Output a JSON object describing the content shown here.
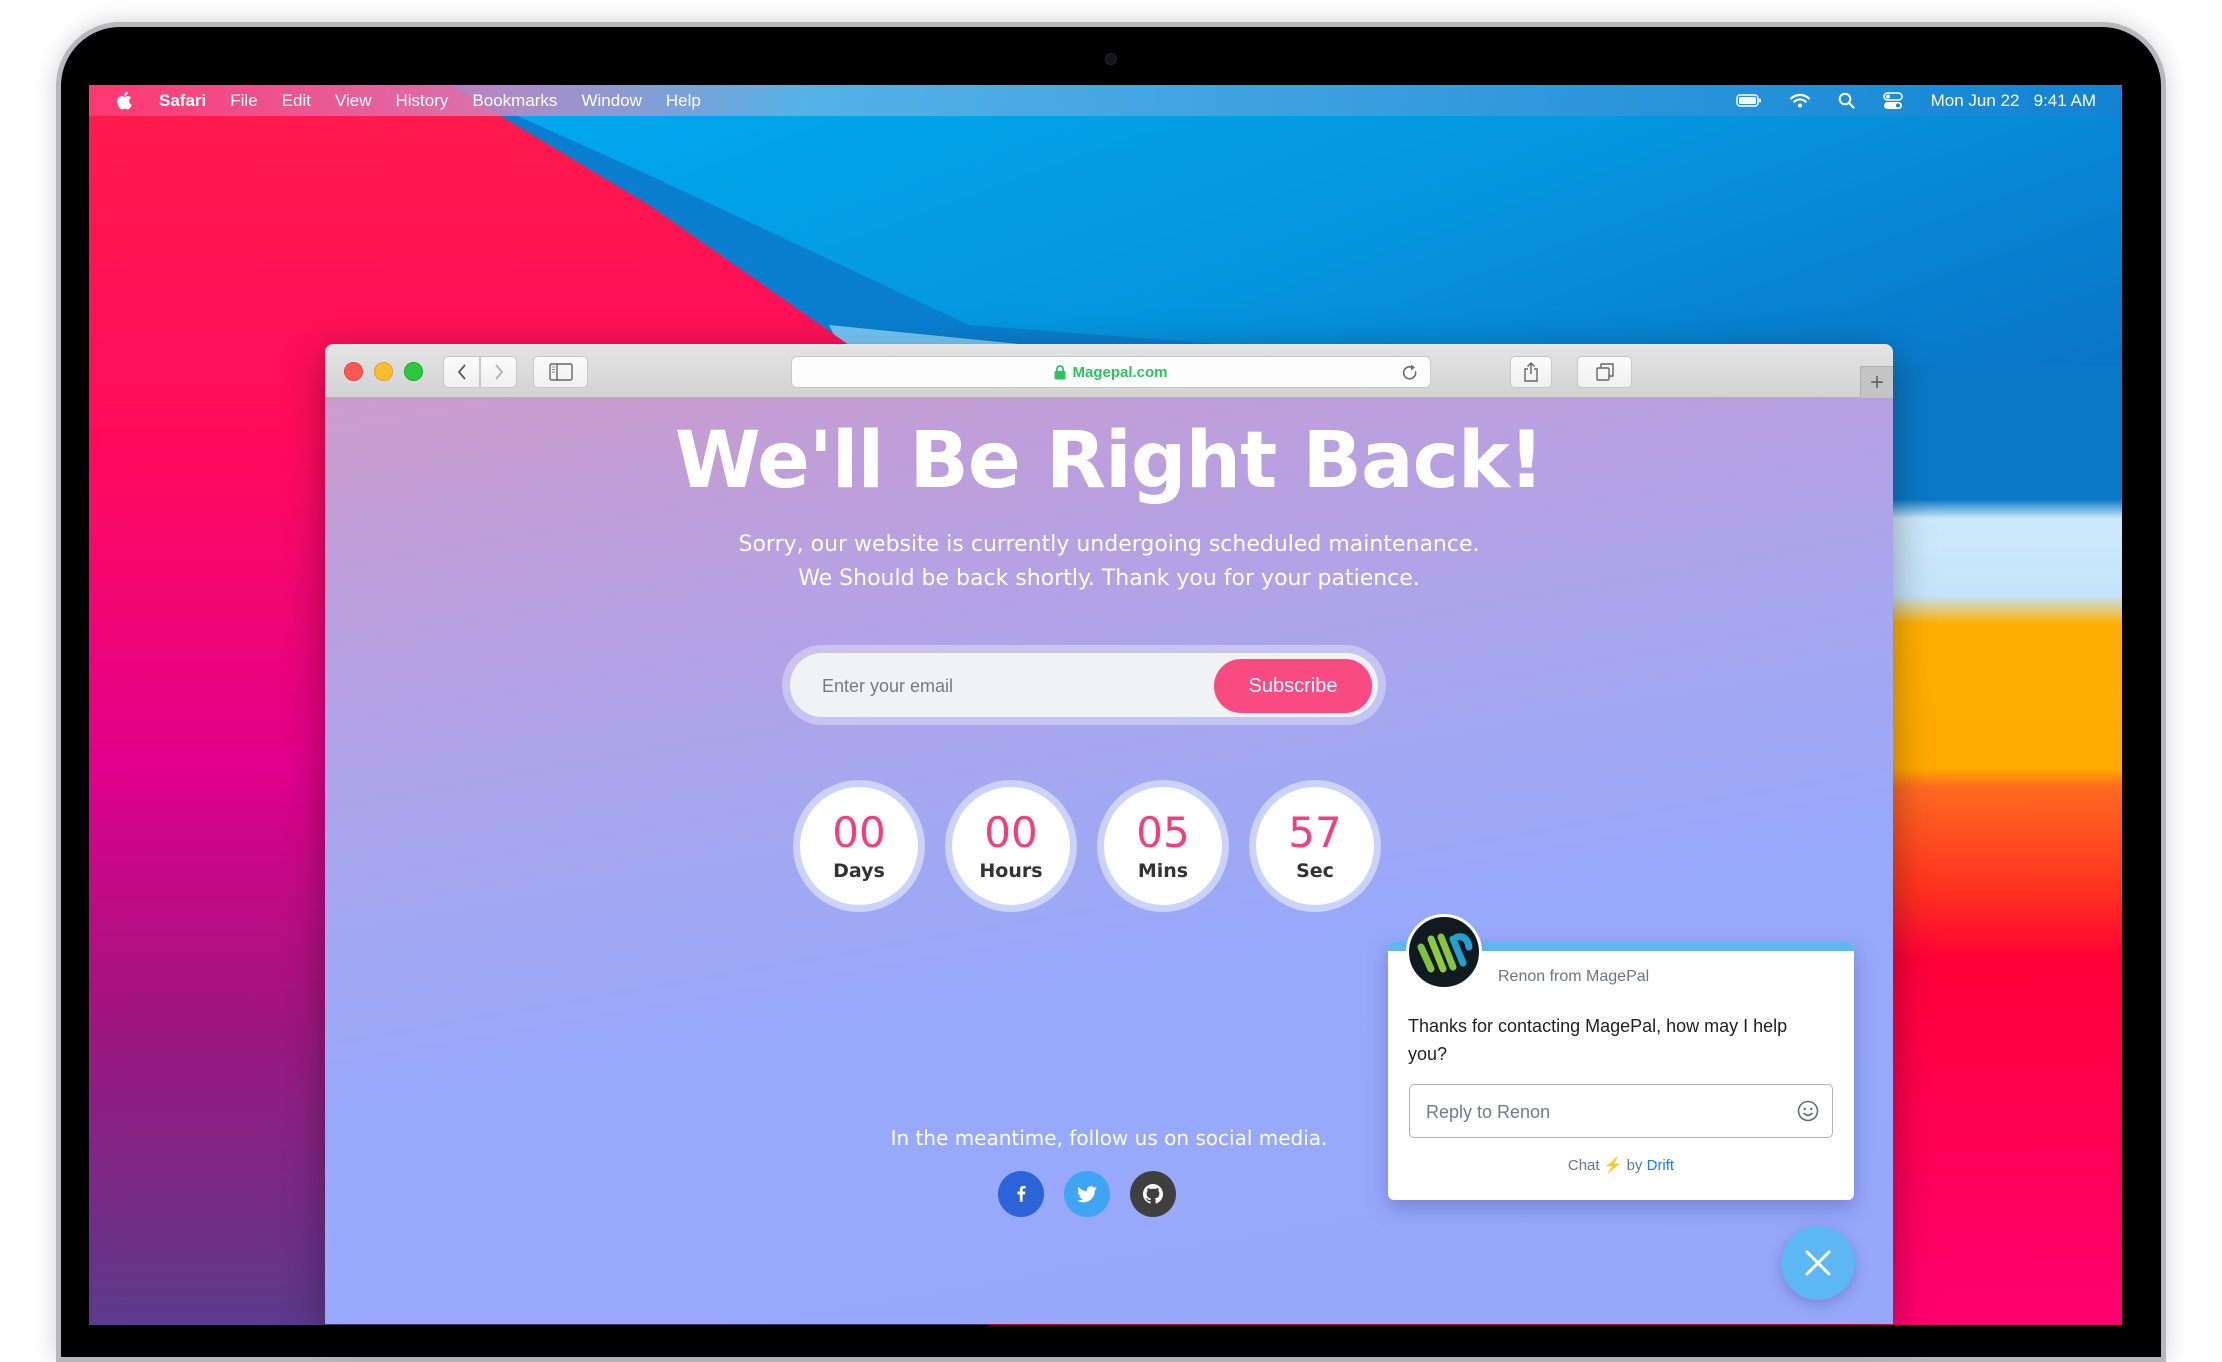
{
  "menubar": {
    "apple_icon": "apple-logo-icon",
    "items": [
      "Safari",
      "File",
      "Edit",
      "View",
      "History",
      "Bookmarks",
      "Window",
      "Help"
    ],
    "status_icons": [
      "battery-icon",
      "wifi-icon",
      "spotlight-search-icon",
      "control-center-icon"
    ],
    "date": "Mon Jun 22",
    "time": "9:41 AM"
  },
  "browser": {
    "url": "Magepal.com",
    "secure": true,
    "toolbar_icons": [
      "back-icon",
      "forward-icon",
      "sidebar-icon",
      "reload-icon",
      "share-icon",
      "tabs-overview-icon",
      "new-tab-icon"
    ],
    "new_tab_label": "+"
  },
  "page": {
    "headline": "We'll Be Right Back!",
    "subtitle_line1": "Sorry, our website is currently undergoing scheduled maintenance.",
    "subtitle_line2": "We Should be back shortly. Thank you for your patience.",
    "subscribe": {
      "email_placeholder": "Enter your email",
      "email_value": "",
      "button_label": "Subscribe"
    },
    "countdown": [
      {
        "value": "00",
        "label": "Days"
      },
      {
        "value": "00",
        "label": "Hours"
      },
      {
        "value": "05",
        "label": "Mins"
      },
      {
        "value": "57",
        "label": "Sec"
      }
    ],
    "social_text": "In the meantime, follow us on social media.",
    "social": [
      {
        "name": "facebook",
        "icon": "facebook-icon",
        "color": "#2d63d8"
      },
      {
        "name": "twitter",
        "icon": "twitter-icon",
        "color": "#3da5f4"
      },
      {
        "name": "github",
        "icon": "github-icon",
        "color": "#3f3f3f"
      }
    ],
    "accent_color": "#fa4a82"
  },
  "chat": {
    "sender": "Renon from MagePal",
    "message": "Thanks for contacting MagePal, how may I help you?",
    "reply_placeholder": "Reply to Renon",
    "powered_prefix": "Chat",
    "powered_by": "by",
    "powered_brand": "Drift",
    "accent_color": "#5db7f3"
  }
}
